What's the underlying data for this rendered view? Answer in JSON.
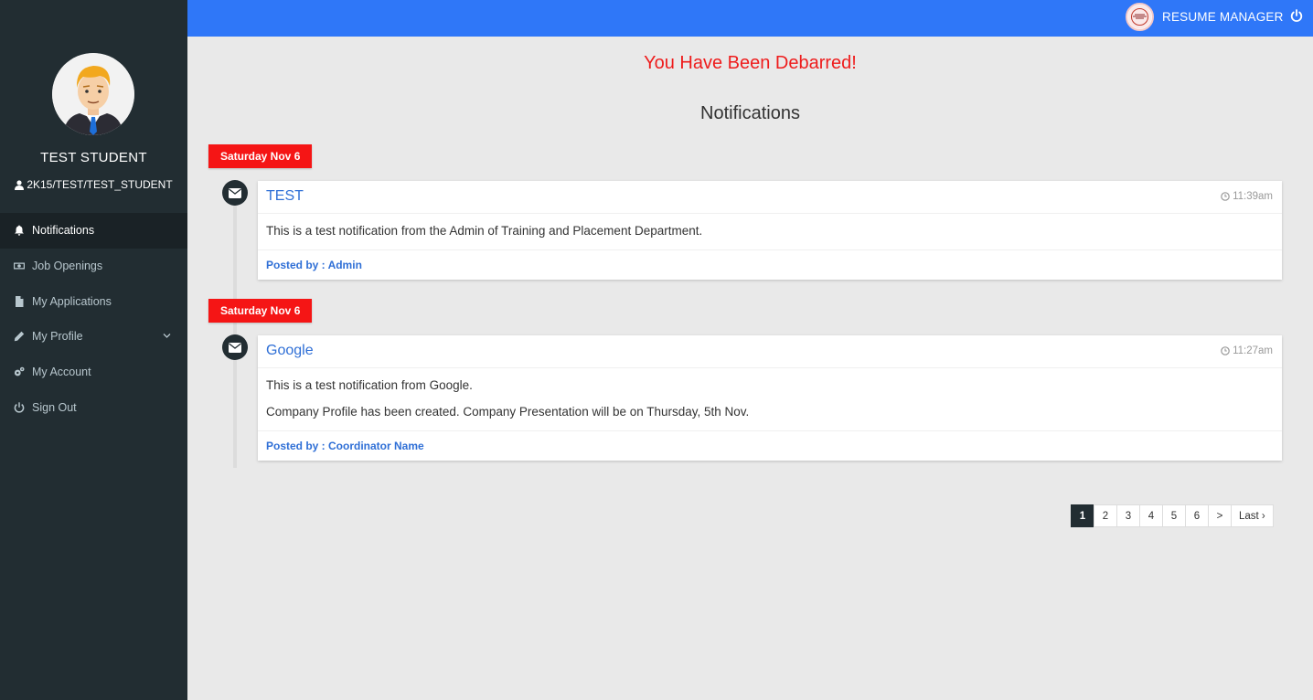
{
  "sidebar": {
    "user_name": "TEST STUDENT",
    "user_id": "2K15/TEST/TEST_STUDENT",
    "menu": [
      {
        "label": "Notifications",
        "icon": "bell-icon",
        "active": true
      },
      {
        "label": "Job Openings",
        "icon": "money-icon",
        "active": false
      },
      {
        "label": "My Applications",
        "icon": "file-icon",
        "active": false
      },
      {
        "label": "My Profile",
        "icon": "pencil-icon",
        "active": false
      },
      {
        "label": "My Account",
        "icon": "gears-icon",
        "active": false
      },
      {
        "label": "Sign Out",
        "icon": "power-icon",
        "active": false
      }
    ]
  },
  "topbar": {
    "brand": "RESUME MANAGER"
  },
  "main": {
    "alert": "You Have Been Debarred!",
    "title": "Notifications",
    "notifications": [
      {
        "date": "Saturday Nov 6",
        "title": "TEST",
        "time": "11:39am",
        "body": [
          "This is a test notification from the Admin of Training and Placement Department."
        ],
        "footer": "Posted by : Admin"
      },
      {
        "date": "Saturday Nov 6",
        "title": "Google",
        "time": "11:27am",
        "body": [
          "This is a test notification from Google.",
          "Company Profile has been created. Company Presentation will be on Thursday, 5th Nov."
        ],
        "footer": "Posted by : Coordinator Name"
      }
    ]
  },
  "pagination": {
    "pages": [
      "1",
      "2",
      "3",
      "4",
      "5",
      "6",
      ">",
      "Last ›"
    ],
    "current": "1"
  },
  "colors": {
    "topbar": "#2f77f8",
    "sidebar": "#222d32",
    "alert": "#ee1c1c",
    "date_label": "#f51515",
    "link": "#2f6fd6"
  }
}
